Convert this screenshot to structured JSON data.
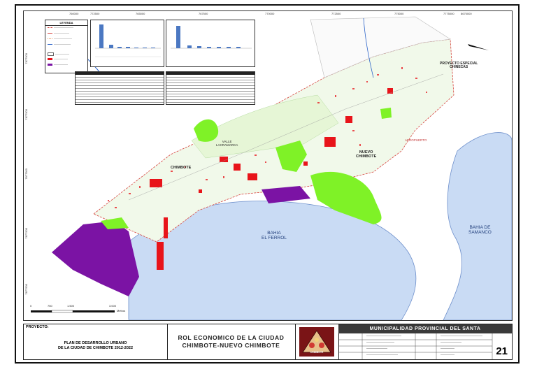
{
  "map": {
    "top_coords": [
      "760000",
      "772500",
      "765000",
      "767500",
      "770000",
      "772500",
      "775000",
      "7775000",
      "8675000"
    ],
    "left_coords": [
      "7877500",
      "7877500",
      "7877500",
      "7877500",
      "7877500"
    ],
    "labels": {
      "special_project": "PROYECTO ESPECIAL\nCHINECAS",
      "valley": "VALLE\nLACRAMARCA",
      "chimbote": "CHIMBOTE",
      "nuevo_chimbote": "NUEVO\nCHIMBOTE",
      "airport": "AEROPUERTO",
      "bay_ferrol": "BAHIA\nEL FERROL",
      "bay_samanco": "BAHIA DE\nSAMANCO"
    },
    "scale_labels": [
      "0",
      "750",
      "1.500",
      "3.000",
      "Metros"
    ],
    "legend_title": "LEYENDA",
    "colors": {
      "sea": "#c9dbf4",
      "sea_stroke": "#6d8fcb",
      "green": "#7ff227",
      "red": "#e8141a",
      "purple": "#7b13a4",
      "light_green": "#e6f6d6",
      "boundary": "#d6433d"
    }
  },
  "titleblock": {
    "project_label": "PROYECTO:",
    "plan_title": "PLAN DE DESARROLLO URBANO\nDE LA CIUDAD DE CHIMBOTE 2012-2022",
    "map_title": "ROL ECONOMICO DE LA CIUDAD\nCHIMBOTE-NUEVO CHIMBOTE",
    "municipality": "MUNICIPALIDAD PROVINCIAL DEL SANTA",
    "logo_text": "CHIMBOTE",
    "sheet_number": "21"
  }
}
